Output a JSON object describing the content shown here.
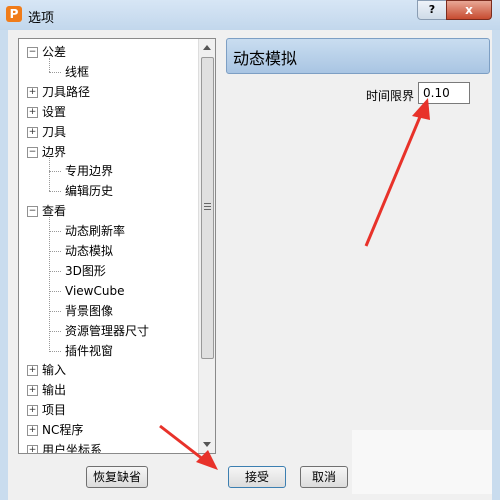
{
  "window": {
    "title": "选项",
    "help_label": "?",
    "close_label": "x",
    "app_icon_letter": "P"
  },
  "tree": {
    "items": [
      {
        "label": "公差",
        "level": 0,
        "toggle": "−"
      },
      {
        "label": "线框",
        "level": 1
      },
      {
        "label": "刀具路径",
        "level": 0,
        "toggle": "+"
      },
      {
        "label": "设置",
        "level": 0,
        "toggle": "+"
      },
      {
        "label": "刀具",
        "level": 0,
        "toggle": "+"
      },
      {
        "label": "边界",
        "level": 0,
        "toggle": "−"
      },
      {
        "label": "专用边界",
        "level": 1
      },
      {
        "label": "编辑历史",
        "level": 1
      },
      {
        "label": "查看",
        "level": 0,
        "toggle": "−"
      },
      {
        "label": "动态刷新率",
        "level": 1
      },
      {
        "label": "动态模拟",
        "level": 1
      },
      {
        "label": "3D图形",
        "level": 1
      },
      {
        "label": "ViewCube",
        "level": 1
      },
      {
        "label": "背景图像",
        "level": 1
      },
      {
        "label": "资源管理器尺寸",
        "level": 1
      },
      {
        "label": "插件视窗",
        "level": 1
      },
      {
        "label": "输入",
        "level": 0,
        "toggle": "+"
      },
      {
        "label": "输出",
        "level": 0,
        "toggle": "+"
      },
      {
        "label": "项目",
        "level": 0,
        "toggle": "+"
      },
      {
        "label": "NC程序",
        "level": 0,
        "toggle": "+"
      },
      {
        "label": "用户坐标系",
        "level": 0,
        "toggle": "+"
      }
    ]
  },
  "panel": {
    "header": "动态模拟",
    "time_limit_label": "时间限界",
    "time_limit_value": "0.10"
  },
  "buttons": {
    "restore_defaults": "恢复缺省",
    "accept": "接受",
    "cancel": "取消"
  },
  "colors": {
    "annotation_arrow": "#e8322a",
    "header_bar": "#b8d0ea"
  }
}
